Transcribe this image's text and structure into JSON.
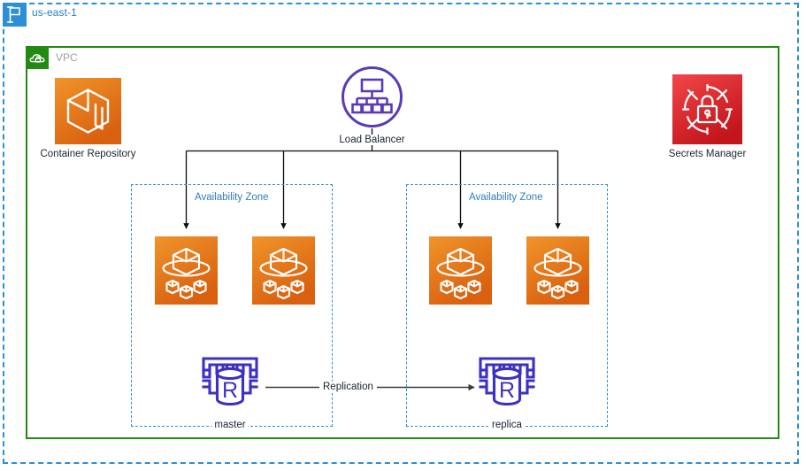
{
  "region": {
    "label": "us-east-1",
    "icon": "region-flag-icon",
    "badge_color": "#2d8fd5",
    "border_color": "#2d8fd5"
  },
  "vpc": {
    "label": "VPC",
    "icon": "vpc-cloud-lock-icon",
    "badge_color": "#248814",
    "border_color": "#248814"
  },
  "nodes": {
    "container_repository": {
      "label": "Container Repository",
      "icon": "container-repository-icon",
      "color": "#e8911a"
    },
    "load_balancer": {
      "label": "Load Balancer",
      "icon": "load-balancer-icon",
      "color": "#5b3bb5"
    },
    "secrets_manager": {
      "label": "Secrets Manager",
      "icon": "secrets-manager-icon",
      "color": "#d82b2b"
    },
    "database_master": {
      "label": "master",
      "icon": "rds-database-icon",
      "color": "#3c31c4"
    },
    "database_replica": {
      "label": "replica",
      "icon": "rds-database-icon",
      "color": "#3c31c4"
    }
  },
  "availability_zones": [
    {
      "label": "Availability Zone",
      "tasks": [
        {
          "label": "",
          "icon": "ecs-task-icon"
        },
        {
          "label": "",
          "icon": "ecs-task-icon"
        }
      ]
    },
    {
      "label": "Availability Zone",
      "tasks": [
        {
          "label": "",
          "icon": "ecs-task-icon"
        },
        {
          "label": "",
          "icon": "ecs-task-icon"
        }
      ]
    }
  ],
  "edges": {
    "replication": {
      "label": "Replication",
      "from": "master",
      "to": "replica"
    }
  }
}
